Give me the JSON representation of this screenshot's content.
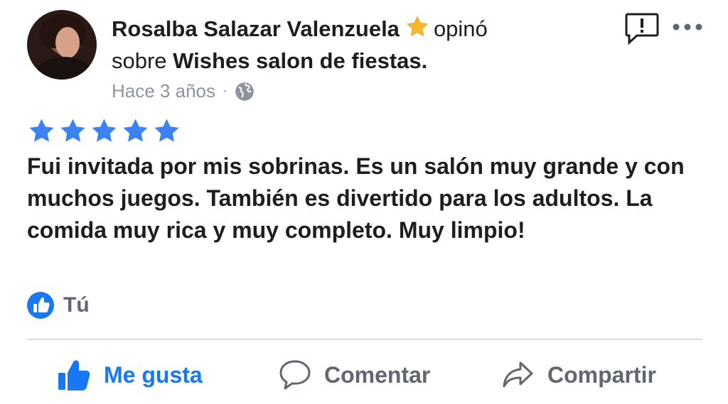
{
  "review": {
    "author_name": "Rosalba Salazar Valenzuela",
    "verb": "opinó",
    "preposition": "sobre",
    "place_name": "Wishes salon de fiestas.",
    "time_ago": "Hace 3 años",
    "meta_separator": "·",
    "rating": 5,
    "text": "Fui invitada por mis sobrinas. Es un salón muy grande y con muchos juegos. También es divertido para los adultos. La comida muy rica y muy completo. Muy limpio!",
    "reactions_label": "Tú"
  },
  "actions": {
    "like": "Me gusta",
    "comment": "Comentar",
    "share": "Compartir"
  },
  "icons": {
    "badge": "star-badge-icon",
    "privacy": "globe-icon",
    "report": "report-icon",
    "more": "more-icon",
    "like": "thumbs-up-icon",
    "comment": "comment-icon",
    "share": "share-icon"
  },
  "colors": {
    "accent": "#1877f2",
    "rating_star": "#3b82f6",
    "badge_star": "#f7b928",
    "muted": "#8d949e",
    "action_gray": "#606770"
  }
}
